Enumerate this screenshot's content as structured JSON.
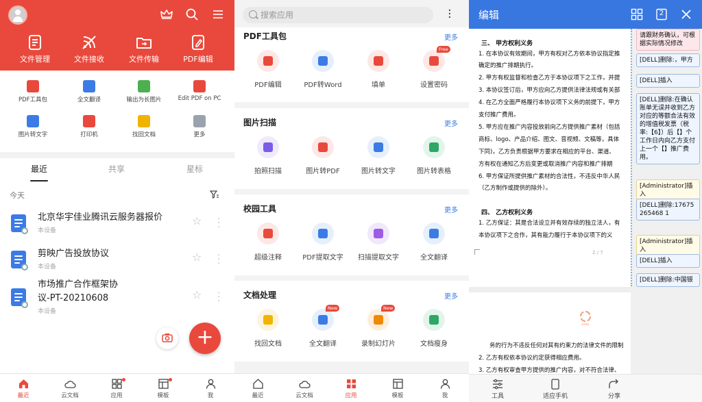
{
  "colors": {
    "primary_red": "#e9493c",
    "link_blue": "#3c7be6",
    "header_blue": "#3877e0"
  },
  "panel1": {
    "header_icons": [
      "crown-icon",
      "search-icon",
      "menu-icon"
    ],
    "big_tools": [
      {
        "label": "文件管理",
        "icon": "file-manager-icon"
      },
      {
        "label": "文件接收",
        "icon": "file-receive-icon"
      },
      {
        "label": "文件传输",
        "icon": "file-transfer-icon"
      },
      {
        "label": "PDF编辑",
        "icon": "pdf-edit-icon"
      }
    ],
    "small_tools": [
      {
        "label": "PDF工具包",
        "icon": "pdf-toolkit-icon",
        "color": "#e9493c"
      },
      {
        "label": "全文翻译",
        "icon": "translate-icon",
        "color": "#3c7be6"
      },
      {
        "label": "输出为长图片",
        "icon": "export-long-image-icon",
        "color": "#4caf50"
      },
      {
        "label": "Edit PDF on PC",
        "icon": "edit-pdf-pc-icon",
        "color": "#e9493c"
      },
      {
        "label": "图片转文字",
        "icon": "image-to-text-icon",
        "color": "#3c7be6"
      },
      {
        "label": "打印机",
        "icon": "printer-icon",
        "color": "#e9493c"
      },
      {
        "label": "找回文档",
        "icon": "recover-doc-icon",
        "color": "#f0b400"
      },
      {
        "label": "更多",
        "icon": "more-grid-icon",
        "color": "#9aa3ad"
      }
    ],
    "tabs": [
      "最近",
      "共享",
      "星标"
    ],
    "today_label": "今天",
    "files": [
      {
        "name_lines": [
          "北京华宇佳业腾讯云服务器报价"
        ],
        "sub": "本设备"
      },
      {
        "name_lines": [
          "剪映广告投放协议"
        ],
        "sub": "本设备"
      },
      {
        "name_lines": [
          "市场推广合作框架协",
          "议-PT-20210608"
        ],
        "sub": "本设备"
      }
    ],
    "fab_label": "+",
    "bottom_nav": [
      {
        "label": "最近",
        "icon": "home-icon",
        "active": true
      },
      {
        "label": "云文档",
        "icon": "cloud-icon",
        "active": false
      },
      {
        "label": "应用",
        "icon": "apps-icon",
        "active": false
      },
      {
        "label": "模板",
        "icon": "template-icon",
        "active": false
      },
      {
        "label": "我",
        "icon": "person-icon",
        "active": false
      }
    ]
  },
  "panel2": {
    "search_placeholder": "搜索应用",
    "sections": [
      {
        "title": "PDF工具包",
        "more": "更多",
        "apps": [
          {
            "label": "PDF编辑",
            "icon": "pdf-edit-icon",
            "color": "#e9493c",
            "badge": ""
          },
          {
            "label": "PDF转Word",
            "icon": "pdf-to-word-icon",
            "color": "#3c7be6",
            "badge": ""
          },
          {
            "label": "填单",
            "icon": "fill-form-icon",
            "color": "#e9493c",
            "badge": ""
          },
          {
            "label": "设置密码",
            "icon": "lock-icon",
            "color": "#e9493c",
            "badge": "Free"
          }
        ]
      },
      {
        "title": "图片扫描",
        "more": "更多",
        "apps": [
          {
            "label": "拍照扫描",
            "icon": "photo-scan-icon",
            "color": "#7c5ce6",
            "badge": ""
          },
          {
            "label": "图片转PDF",
            "icon": "image-to-pdf-icon",
            "color": "#e9493c",
            "badge": ""
          },
          {
            "label": "图片转文字",
            "icon": "image-to-text-icon",
            "color": "#3c7be6",
            "badge": ""
          },
          {
            "label": "图片转表格",
            "icon": "image-to-table-icon",
            "color": "#2ea866",
            "badge": ""
          }
        ]
      },
      {
        "title": "校园工具",
        "more": "更多",
        "apps": [
          {
            "label": "超级注释",
            "icon": "annotate-icon",
            "color": "#e9493c",
            "badge": ""
          },
          {
            "label": "PDF提取文字",
            "icon": "pdf-extract-text-icon",
            "color": "#3c7be6",
            "badge": ""
          },
          {
            "label": "扫描提取文字",
            "icon": "scan-extract-text-icon",
            "color": "#9c5ce6",
            "badge": ""
          },
          {
            "label": "全文翻译",
            "icon": "translate-icon",
            "color": "#3c7be6",
            "badge": ""
          }
        ]
      },
      {
        "title": "文档处理",
        "more": "更多",
        "apps": [
          {
            "label": "找回文档",
            "icon": "recover-doc-icon",
            "color": "#f0b400",
            "badge": ""
          },
          {
            "label": "全文翻译",
            "icon": "translate-icon",
            "color": "#3c7be6",
            "badge": "New"
          },
          {
            "label": "录制幻灯片",
            "icon": "record-slides-icon",
            "color": "#f08a00",
            "badge": "New"
          },
          {
            "label": "文档瘦身",
            "icon": "slim-doc-icon",
            "color": "#2ea866",
            "badge": ""
          }
        ]
      }
    ],
    "bottom_nav": [
      {
        "label": "最近",
        "icon": "home-icon",
        "active": false
      },
      {
        "label": "云文档",
        "icon": "cloud-icon",
        "active": false
      },
      {
        "label": "应用",
        "icon": "apps-icon",
        "active": true
      },
      {
        "label": "模板",
        "icon": "template-icon",
        "active": false
      },
      {
        "label": "我",
        "icon": "person-icon",
        "active": false
      }
    ]
  },
  "panel3": {
    "title": "编辑",
    "header_icons": [
      "grid-icon",
      "page-count-icon",
      "close-icon"
    ],
    "page_count_badge": "2",
    "doc_lines": [
      {
        "type": "head",
        "text": "三、      甲方权利义务"
      },
      {
        "type": "line",
        "text": "1.  在本协议有效期间，甲方有权对乙方依本协议指定推"
      },
      {
        "type": "line",
        "text": "     确定的推广排期执行。"
      },
      {
        "type": "line",
        "text": "2.  甲方有权监督和检查乙方于本协议项下之工作，并提"
      },
      {
        "type": "line",
        "text": "3.  本协议签订后，甲方应向乙方提供法律法规或有关部"
      },
      {
        "type": "line",
        "text": "4.  在乙方全面严格履行本协议项下义务的前提下，甲方"
      },
      {
        "type": "line",
        "text": "     支付推广费用。"
      },
      {
        "type": "line",
        "text": "5.  甲方应在推广内容投放前向乙方提供推广素材（包括"
      },
      {
        "type": "line",
        "text": "     商标、logo、产品介绍、图文、音视频、文稿等，具体"
      },
      {
        "type": "line",
        "text": "     下同)，乙方负责根据甲方要求在相应的平台、渠道、"
      },
      {
        "type": "line",
        "text": "     方有权在通知乙方后变更或取消推广内容和推广排期"
      },
      {
        "type": "line",
        "text": "6.  甲方保证所提供推广素材的合法性，不违反中华人民"
      },
      {
        "type": "line",
        "text": "     （乙方制作或提供的除外）。"
      },
      {
        "type": "head",
        "text": "四、      乙方权利义务"
      },
      {
        "type": "line",
        "text": "1.  乙方保证：其是合法设立并有效存续的独立法人，有"
      },
      {
        "type": "line",
        "text": "     本协议项下之合作，其有能力履行于本协议项下的义"
      }
    ],
    "page_number": "2 / 7",
    "doc_lines_page3": [
      "务的行为不违反任何对其有约束力的法律文件的限制",
      "2.  乙方有权依本协议约定获得相应费用。",
      "3.  乙方有权审查甲方提供的推广内容，对不符合法律、"
    ],
    "comments": [
      {
        "text": "请跟财务确认，可根据实际情况修改",
        "style": "pink"
      },
      {
        "text": "[DELL]删除:，甲方",
        "style": "blue"
      },
      {
        "text": "[DELL]插入",
        "style": "blue"
      },
      {
        "text": "[DELL]删除:在确认账单无误并收到乙方对应的等额合法有效的增值税发票（税率:【6】）后【】个工作日内向乙方支付上一个【】推广费用。",
        "style": "blue"
      },
      {
        "text": "[Administrator]插入",
        "style": "yellow"
      },
      {
        "text": "[DELL]删除:17675265468 1",
        "style": "blue"
      },
      {
        "text": "[Administrator]插入",
        "style": "yellow"
      },
      {
        "text": "[DELL]插入",
        "style": "blue"
      },
      {
        "text": "[DELL]删除:中国银",
        "style": "blue"
      }
    ],
    "bottom_nav": [
      {
        "label": "工具",
        "icon": "tools-icon"
      },
      {
        "label": "适应手机",
        "icon": "fit-phone-icon"
      },
      {
        "label": "分享",
        "icon": "share-icon"
      }
    ]
  }
}
